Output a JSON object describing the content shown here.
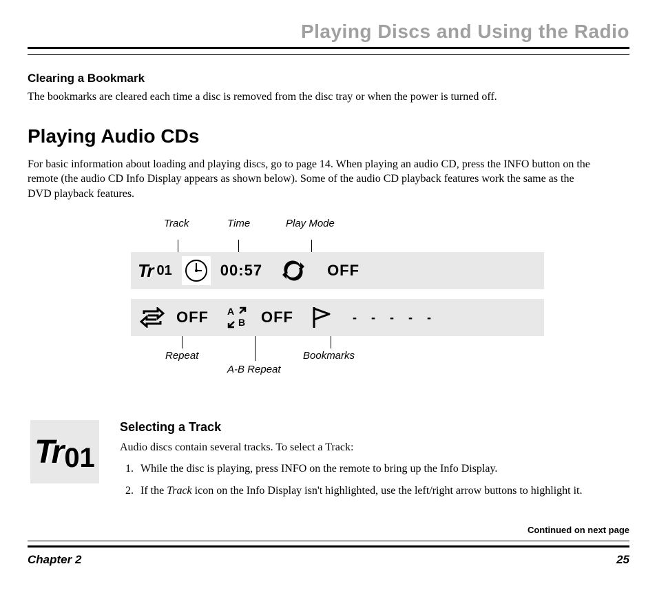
{
  "chapter_header": "Playing Discs and Using the Radio",
  "clearing": {
    "heading": "Clearing a Bookmark",
    "body": "The bookmarks are cleared each time a disc is removed from the disc tray or when the power is turned off."
  },
  "playing_audio": {
    "heading": "Playing Audio CDs",
    "body": "For basic information about loading and playing discs, go to page 14. When playing an audio CD, press the INFO button on the remote (the audio CD Info Display appears as shown below). Some of the audio CD playback features work the same as the DVD playback features."
  },
  "callouts_top": {
    "track": "Track",
    "time": "Time",
    "play_mode": "Play Mode"
  },
  "info_display": {
    "track_num": "01",
    "time": "00:57",
    "play_mode": "OFF",
    "repeat": "OFF",
    "ab_repeat": "OFF",
    "bookmarks": "- - - - -"
  },
  "callouts_bottom": {
    "repeat": "Repeat",
    "ab_repeat": "A-B Repeat",
    "bookmarks": "Bookmarks"
  },
  "selecting": {
    "heading": "Selecting a Track",
    "icon_track": "01",
    "intro": "Audio discs contain several tracks. To select a Track:",
    "step1": "While the disc is playing, press INFO on the remote to bring up the Info Display.",
    "step2_a": "If the ",
    "step2_em": "Track",
    "step2_b": " icon on the Info Display isn't highlighted, use the left/right arrow buttons to highlight it."
  },
  "continued": "Continued on next page",
  "footer": {
    "chapter": "Chapter 2",
    "page": "25"
  }
}
